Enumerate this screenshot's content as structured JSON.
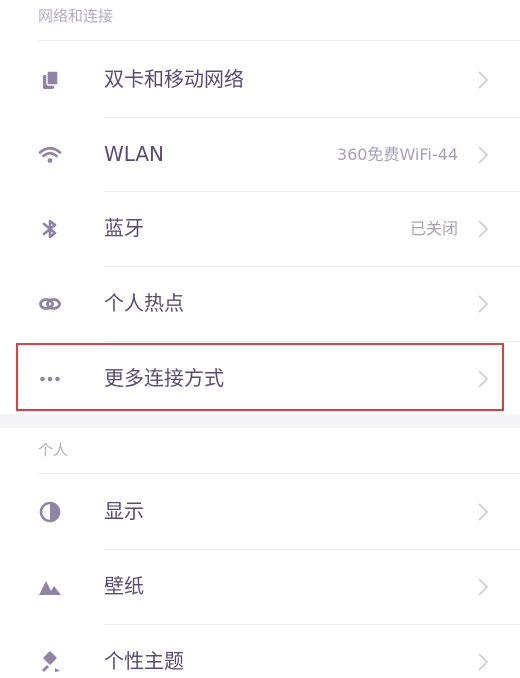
{
  "sections": [
    {
      "header": "网络和连接",
      "items": [
        {
          "label": "双卡和移动网络",
          "value": "",
          "icon": "sim-card-icon"
        },
        {
          "label": "WLAN",
          "value": "360免费WiFi-44",
          "icon": "wifi-icon"
        },
        {
          "label": "蓝牙",
          "value": "已关闭",
          "icon": "bluetooth-icon"
        },
        {
          "label": "个人热点",
          "value": "",
          "icon": "hotspot-icon"
        },
        {
          "label": "更多连接方式",
          "value": "",
          "icon": "more-dots-icon"
        }
      ]
    },
    {
      "header": "个人",
      "items": [
        {
          "label": "显示",
          "value": "",
          "icon": "display-contrast-icon"
        },
        {
          "label": "壁纸",
          "value": "",
          "icon": "wallpaper-mountain-icon"
        },
        {
          "label": "个性主题",
          "value": "",
          "icon": "theme-brush-icon"
        }
      ]
    }
  ],
  "colors": {
    "icon": "#8f83a8",
    "label": "#5a4b75",
    "secondary": "#a89fb5",
    "header": "#b3abc0",
    "highlight": "#d9413f"
  }
}
